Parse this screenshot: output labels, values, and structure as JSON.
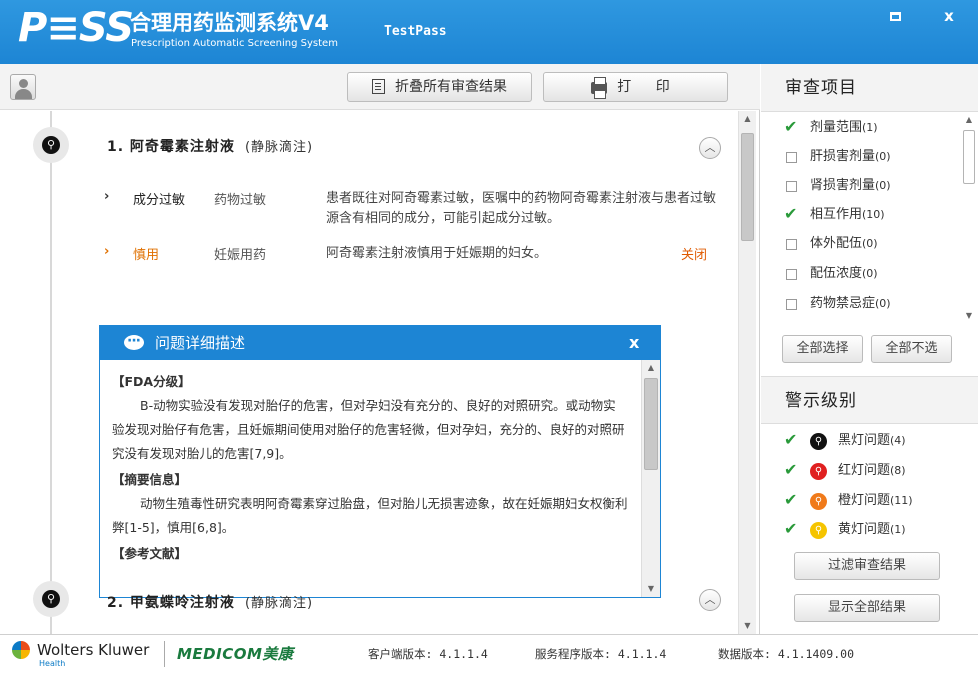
{
  "app": {
    "logo": "P≡SS",
    "title_cn": "合理用药监测系统V4",
    "title_en": "Prescription Automatic Screening System",
    "user": "TestPass"
  },
  "window_controls": {
    "maximize_icon": "maximize-icon",
    "close_label": "x"
  },
  "toolbar": {
    "collapse_label": "折叠所有审查结果",
    "print_label": "打 印"
  },
  "drugs": [
    {
      "index_title": "1. 阿奇霉素注射液",
      "route": "(静脉滴注)",
      "level_color": "#111111",
      "issues": [
        {
          "type": "成分过敏",
          "sub": "药物过敏",
          "desc": "患者既往对阿奇霉素过敏，医嘱中的药物阿奇霉素注射液与患者过敏源含有相同的成分，可能引起成分过敏。",
          "color": "#222222"
        },
        {
          "type": "慎用",
          "sub": "妊娠用药",
          "desc": "阿奇霉素注射液慎用于妊娠期的妇女。",
          "color": "#e07000",
          "action": "关闭"
        }
      ]
    },
    {
      "index_title": "2. 甲氨蝶呤注射液",
      "route": "(静脉滴注)",
      "level_color": "#111111"
    }
  ],
  "popup": {
    "title": "问题详细描述",
    "close": "x",
    "fda_heading": "【FDA分级】",
    "fda_text": "B-动物实验没有发现对胎仔的危害，但对孕妇没有充分的、良好的对照研究。或动物实验发现对胎仔有危害，且妊娠期间使用对胎仔的危害轻微，但对孕妇，充分的、良好的对照研究没有发现对胎儿的危害[7,9]。",
    "summary_heading": "【摘要信息】",
    "summary_text": "动物生殖毒性研究表明阿奇霉素穿过胎盘，但对胎儿无损害迹象，故在妊娠期妇女权衡利弊[1-5]，慎用[6,8]。",
    "ref_heading": "【参考文献】"
  },
  "review_items": {
    "heading": "审查项目",
    "items": [
      {
        "label": "剂量范围",
        "count": "(1)",
        "checked": true
      },
      {
        "label": "肝损害剂量",
        "count": "(0)",
        "checked": false
      },
      {
        "label": "肾损害剂量",
        "count": "(0)",
        "checked": false
      },
      {
        "label": "相互作用",
        "count": "(10)",
        "checked": true
      },
      {
        "label": "体外配伍",
        "count": "(0)",
        "checked": false
      },
      {
        "label": "配伍浓度",
        "count": "(0)",
        "checked": false
      },
      {
        "label": "药物禁忌症",
        "count": "(0)",
        "checked": false
      }
    ],
    "select_all": "全部选择",
    "select_none": "全部不选"
  },
  "warning_levels": {
    "heading": "警示级别",
    "items": [
      {
        "label": "黑灯问题",
        "count": "(4)",
        "color": "#111111"
      },
      {
        "label": "红灯问题",
        "count": "(8)",
        "color": "#e02020"
      },
      {
        "label": "橙灯问题",
        "count": "(11)",
        "color": "#f07a1a"
      },
      {
        "label": "黄灯问题",
        "count": "(1)",
        "color": "#f5c400"
      }
    ],
    "filter_button": "过滤审查结果",
    "show_all_button": "显示全部结果"
  },
  "status": {
    "wk_name": "Wolters Kluwer",
    "wk_sub": "Health",
    "medicom": "MEDICOM美康",
    "client_version": "客户端版本: 4.1.1.4",
    "server_version": "服务程序版本: 4.1.1.4",
    "data_version": "数据版本: 4.1.1409.00"
  }
}
